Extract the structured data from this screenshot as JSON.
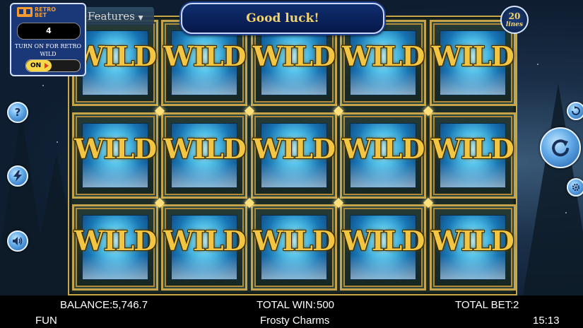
{
  "banner": {
    "message": "Good luck!"
  },
  "features": {
    "label": "Features",
    "arrow": "▼"
  },
  "lines": {
    "count": "20",
    "unit": "lines"
  },
  "retro": {
    "logo_line1": "RETRO",
    "logo_line2": "BET",
    "value": "4",
    "hint": "TURN ON FOR RETRO WILD",
    "toggle_label": "ON"
  },
  "reels": {
    "symbol": "WILD",
    "rows": 3,
    "cols": 5,
    "grid": [
      [
        "WILD",
        "WILD",
        "WILD",
        "WILD",
        "WILD"
      ],
      [
        "WILD",
        "WILD",
        "WILD",
        "WILD",
        "WILD"
      ],
      [
        "WILD",
        "WILD",
        "WILD",
        "WILD",
        "WILD"
      ]
    ]
  },
  "left_buttons": [
    {
      "icon": "help-icon",
      "glyph": "?"
    },
    {
      "icon": "lightning-icon",
      "glyph": "⚡"
    },
    {
      "icon": "sound-icon",
      "glyph": "🔊"
    }
  ],
  "right_buttons": {
    "autoplay_icon": "autoplay-icon",
    "spin_icon": "spin-icon",
    "settings_icon": "gear-icon"
  },
  "status": {
    "balance_label": "BALANCE:",
    "balance": "5,746.7",
    "total_win_label": "TOTAL WIN:",
    "total_win": "500",
    "total_bet_label": "TOTAL BET:",
    "total_bet": "2",
    "mode": "FUN",
    "game_name": "Frosty Charms",
    "time": "15:13"
  },
  "colors": {
    "accent_gold": "#f2c642",
    "panel_blue": "#1a3778",
    "bar": "#000000"
  }
}
